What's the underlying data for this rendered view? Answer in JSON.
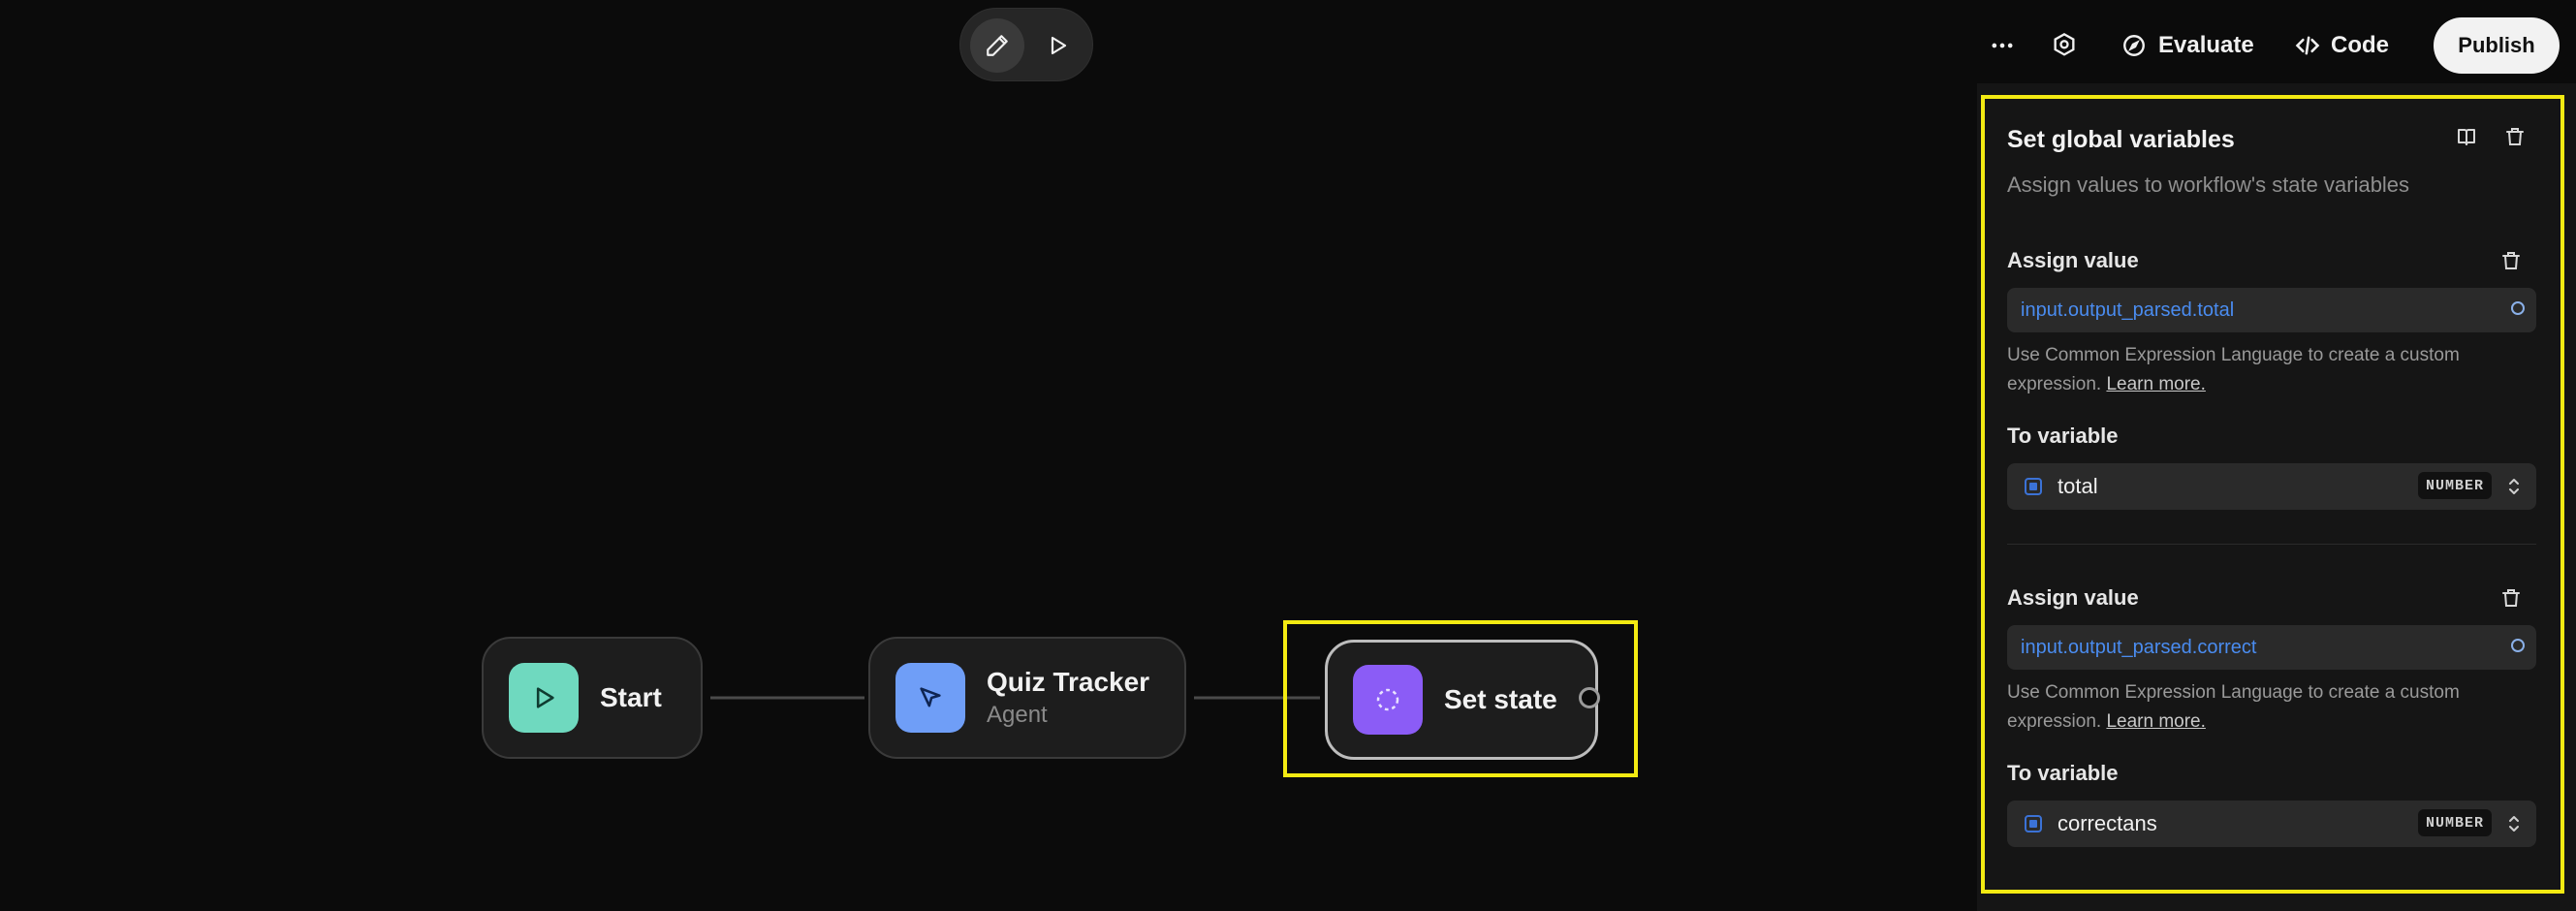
{
  "toolbar": {
    "more_icon": "more-horizontal-icon",
    "settings_icon": "settings-icon",
    "evaluate_label": "Evaluate",
    "code_label": "Code",
    "publish_label": "Publish"
  },
  "mode_toggle": {
    "edit_icon": "pencil-icon",
    "run_icon": "play-icon"
  },
  "nodes": {
    "start": {
      "title": "Start",
      "icon": "play-icon",
      "color": "#6fd9bf"
    },
    "quiz": {
      "title": "Quiz Tracker",
      "subtitle": "Agent",
      "icon": "cursor-icon",
      "color": "#6f9ef7"
    },
    "set_state": {
      "title": "Set state",
      "icon": "dashed-circle-icon",
      "color": "#8b5cf6"
    }
  },
  "panel": {
    "title": "Set global variables",
    "description": "Assign values to workflow's state variables",
    "assignments": [
      {
        "label": "Assign value",
        "expression": "input.output_parsed.total",
        "help_text": "Use Common Expression Language to create a custom expression.",
        "help_link": "Learn more.",
        "to_label": "To variable",
        "variable": "total",
        "type": "NUMBER"
      },
      {
        "label": "Assign value",
        "expression": "input.output_parsed.correct",
        "help_text": "Use Common Expression Language to create a custom expression.",
        "help_link": "Learn more.",
        "to_label": "To variable",
        "variable": "correctans",
        "type": "NUMBER"
      }
    ]
  },
  "colors": {
    "highlight": "#f3ea12",
    "expression_text": "#4a8cf0"
  }
}
